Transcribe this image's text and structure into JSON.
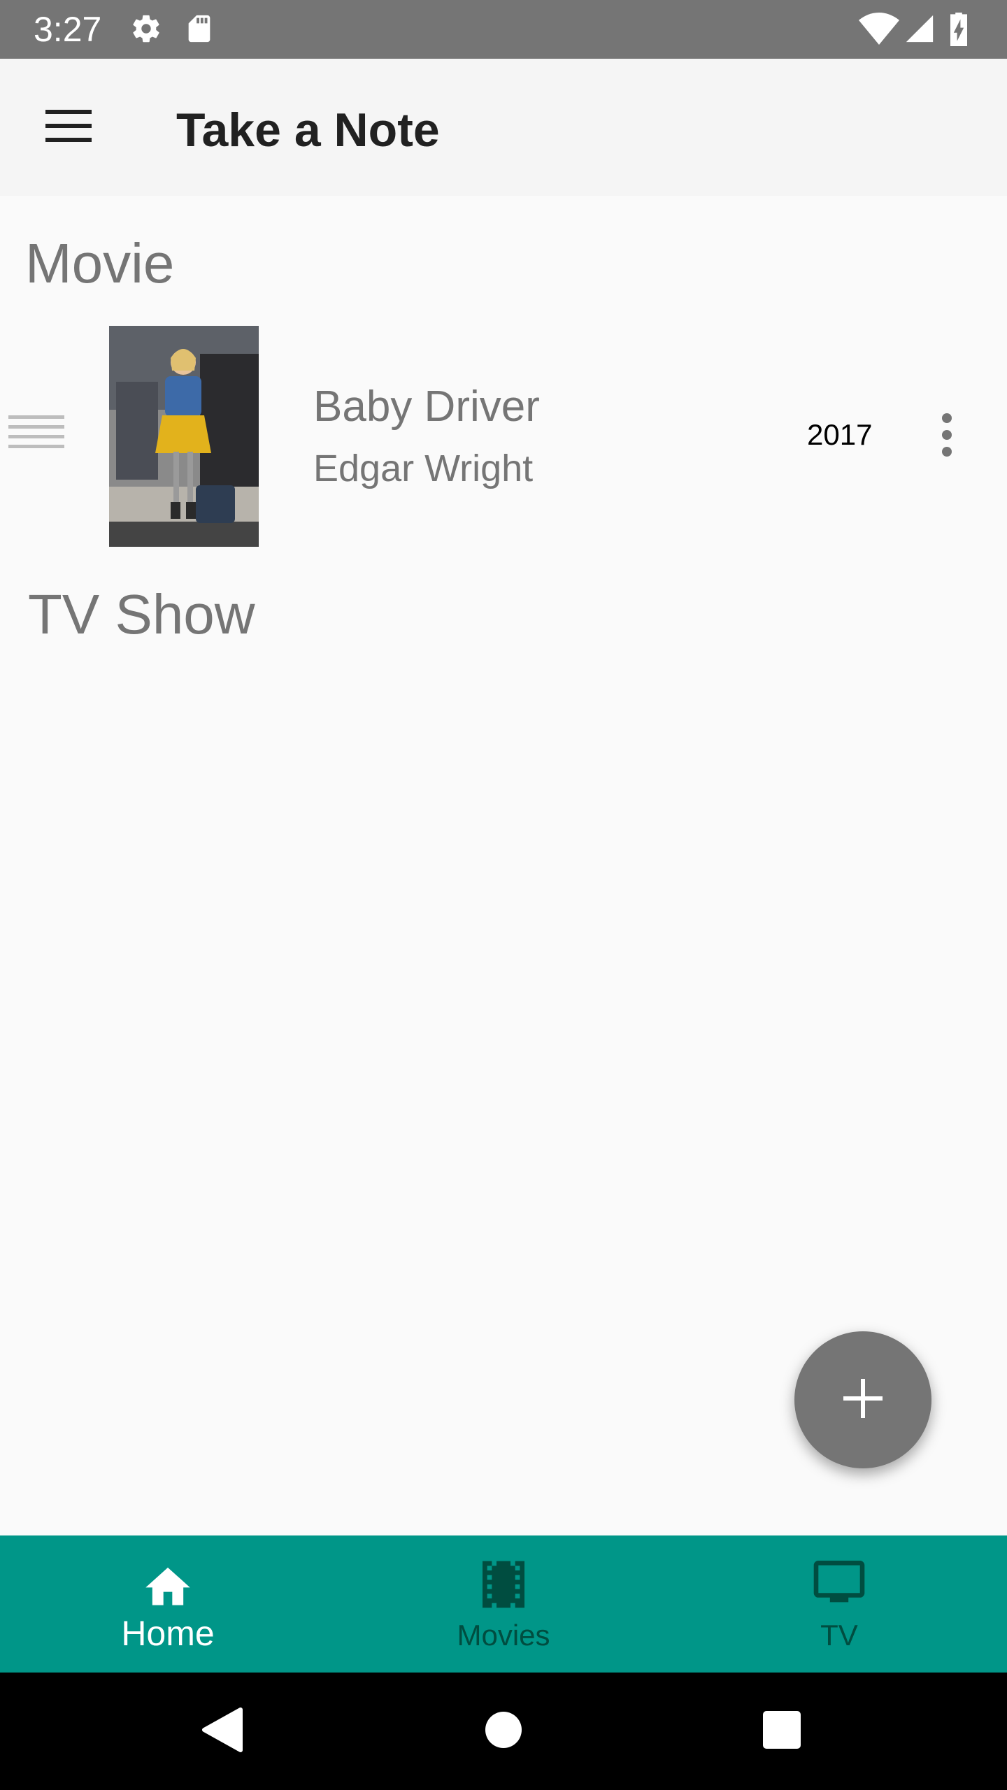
{
  "status_bar": {
    "time": "3:27",
    "icons": [
      "settings-icon",
      "sd-card-icon",
      "wifi-icon",
      "signal-icon",
      "battery-charging-icon"
    ]
  },
  "app_bar": {
    "title": "Take a Note",
    "menu_icon": "hamburger-menu-icon"
  },
  "sections": {
    "movie": {
      "header": "Movie"
    },
    "tv": {
      "header": "TV Show"
    }
  },
  "movies": [
    {
      "title": "Baby Driver",
      "director": "Edgar Wright",
      "year": "2017"
    }
  ],
  "fab": {
    "icon": "plus-icon"
  },
  "bottom_nav": {
    "items": [
      {
        "label": "Home",
        "icon": "home-icon",
        "selected": true
      },
      {
        "label": "Movies",
        "icon": "film-icon",
        "selected": false
      },
      {
        "label": "TV",
        "icon": "tv-icon",
        "selected": false
      }
    ]
  },
  "colors": {
    "status_bar": "#757575",
    "app_bar": "#f5f5f5",
    "background": "#fafafa",
    "accent": "#009688",
    "fab": "#757575",
    "nav_selected": "#ffffff",
    "nav_unselected": "#004d40"
  }
}
